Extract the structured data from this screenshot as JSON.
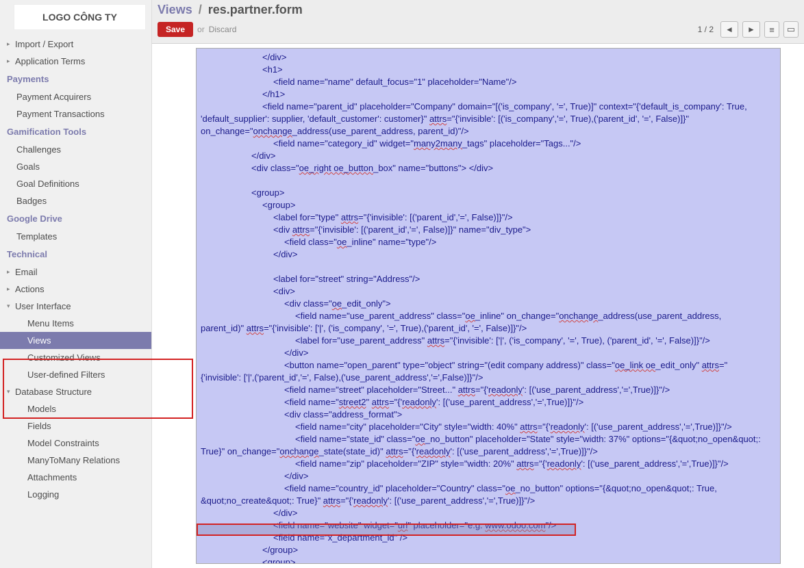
{
  "logo": "LOGO CÔNG TY",
  "sidebar": {
    "import_export": "Import / Export",
    "app_terms": "Application Terms",
    "payments_header": "Payments",
    "payment_acquirers": "Payment Acquirers",
    "payment_transactions": "Payment Transactions",
    "gamification_header": "Gamification Tools",
    "challenges": "Challenges",
    "goals": "Goals",
    "goal_definitions": "Goal Definitions",
    "badges": "Badges",
    "google_drive_header": "Google Drive",
    "templates": "Templates",
    "technical_header": "Technical",
    "email": "Email",
    "actions": "Actions",
    "user_interface": "User Interface",
    "menu_items": "Menu Items",
    "views": "Views",
    "customized_views": "Customized Views",
    "user_defined_filters": "User-defined Filters",
    "database_structure": "Database Structure",
    "models": "Models",
    "fields": "Fields",
    "model_constraints": "Model Constraints",
    "m2m_relations": "ManyToMany Relations",
    "attachments": "Attachments",
    "logging": "Logging"
  },
  "breadcrumb": {
    "views": "Views",
    "slash": "/",
    "current": "res.partner.form"
  },
  "toolbar": {
    "save": "Save",
    "or": "or",
    "discard": "Discard",
    "pager": "1 / 2"
  },
  "code": {
    "l01": "</div>",
    "l02": "<h1>",
    "l03": "<field name=\"name\" default_focus=\"1\" placeholder=\"Name\"/>",
    "l04": "</h1>",
    "l05a": "<field name=\"parent_id\" placeholder=\"Company\" domain=\"[('is_company', '=', True)]\" context=\"{'default_is_company': True,",
    "l05b": "'default_supplier': supplier, 'default_customer': customer}\" ",
    "l05c": "attrs",
    "l05d": "=\"{'invisible': [('is_company','=', True),('parent_id', '=', False)]}\"",
    "l05e": "on_change=\"",
    "l05f": "onchange",
    "l05g": "_address(use_parent_address, parent_id)\"/>",
    "l06a": "<field name=\"category_id\" widget=\"",
    "l06b": "many2many",
    "l06c": "_tags\" placeholder=\"Tags...\"/>",
    "l07": "</div>",
    "l08a": "<div class=\"",
    "l08b": "oe_right oe_button",
    "l08c": "_box\" name=\"buttons\"> </div>",
    "l09": "<group>",
    "l10": "<group>",
    "l11a": "<label for=\"type\" ",
    "l11b": "attrs",
    "l11c": "=\"{'invisible': [('parent_id','=', False)]}\"/>",
    "l12a": "<div ",
    "l12b": "attrs",
    "l12c": "=\"{'invisible': [('parent_id','=', False)]}\" name=\"div_type\">",
    "l13a": "<field class=\"",
    "l13b": "oe",
    "l13c": "_inline\" name=\"type\"/>",
    "l14": "</div>",
    "l15": "<label for=\"street\" string=\"Address\"/>",
    "l16": "<div>",
    "l17a": "<div class=\"",
    "l17b": "oe",
    "l17c": "_edit_only\">",
    "l18a": "<field name=\"use_parent_address\" class=\"",
    "l18b": "oe",
    "l18c": "_inline\" on_change=\"",
    "l18d": "onchange",
    "l18e": "_address(use_parent_address,",
    "l18f": "parent_id)\" ",
    "l18g": "attrs",
    "l18h": "=\"{'invisible': ['|', ('is_company', '=', True),('parent_id', '=', False)]}\"/>",
    "l19a": "<label for=\"use_parent_address\" ",
    "l19b": "attrs",
    "l19c": "=\"{'invisible': ['|', ('is_company', '=', True), ('parent_id', '=', False)]}\"/>",
    "l20": "</div>",
    "l21a": "<button name=\"open_parent\" type=\"object\" string=\"(edit company address)\" class=\"",
    "l21b": "oe_link oe",
    "l21c": "_edit_only\" ",
    "l21d": "attrs",
    "l21e": "=\"",
    "l21f": "{'invisible': ['|',('parent_id','=', False),('use_parent_address','=',False)]}\"/>",
    "l22a": "<field name=\"street\" placeholder=\"Street...\" ",
    "l22b": "attrs",
    "l22c": "=\"{'",
    "l22d": "readonly",
    "l22e": "': [('use_parent_address','=',True)]}\"/>",
    "l23a": "<field name=\"",
    "l23b": "street2",
    "l23c": "\" ",
    "l23d": "attrs",
    "l23e": "=\"{'",
    "l23f": "readonly",
    "l23g": "': [('use_parent_address','=',True)]}\"/>",
    "l24": "<div class=\"address_format\">",
    "l25a": "<field name=\"city\" placeholder=\"City\" style=\"width: 40%\" ",
    "l25b": "attrs",
    "l25c": "=\"{'",
    "l25d": "readonly",
    "l25e": "': [('use_parent_address','=',True)]}\"/>",
    "l26a": "<field name=\"state_id\" class=\"",
    "l26b": "oe",
    "l26c": "_no_button\" placeholder=\"State\" style=\"width: 37%\" options=\"{&quot;no_open&quot;:",
    "l26d": "True}\" on_change=\"",
    "l26e": "onchange",
    "l26f": "_state(state_id)\" ",
    "l26g": "attrs",
    "l26h": "=\"{'",
    "l26i": "readonly",
    "l26j": "': [('use_parent_address','=',True)]}\"/>",
    "l27a": "<field name=\"zip\" placeholder=\"ZIP\" style=\"width: 20%\" ",
    "l27b": "attrs",
    "l27c": "=\"{'",
    "l27d": "readonly",
    "l27e": "': [('use_parent_address','=',True)]}\"/>",
    "l28": "</div>",
    "l29a": "<field name=\"country_id\" placeholder=\"Country\" class=\"",
    "l29b": "oe",
    "l29c": "_no_button\" options=\"{&quot;no_open&quot;: True,",
    "l29d": "&quot;no_create&quot;: True}\" ",
    "l29e": "attrs",
    "l29f": "=\"{'",
    "l29g": "readonly",
    "l29h": "': [('use_parent_address','=',True)]}\"/>",
    "l30": "</div>",
    "l31a": "<field name=\"website\" widget=\"",
    "l31b": "url",
    "l31c": "\" placeholder=\"e.g. ",
    "l31d": "www.odoo.com",
    "l31e": "\"/>",
    "l32": "<field name=\"x_department_id\" />",
    "l33": "</group>",
    "l34": "<group>"
  }
}
